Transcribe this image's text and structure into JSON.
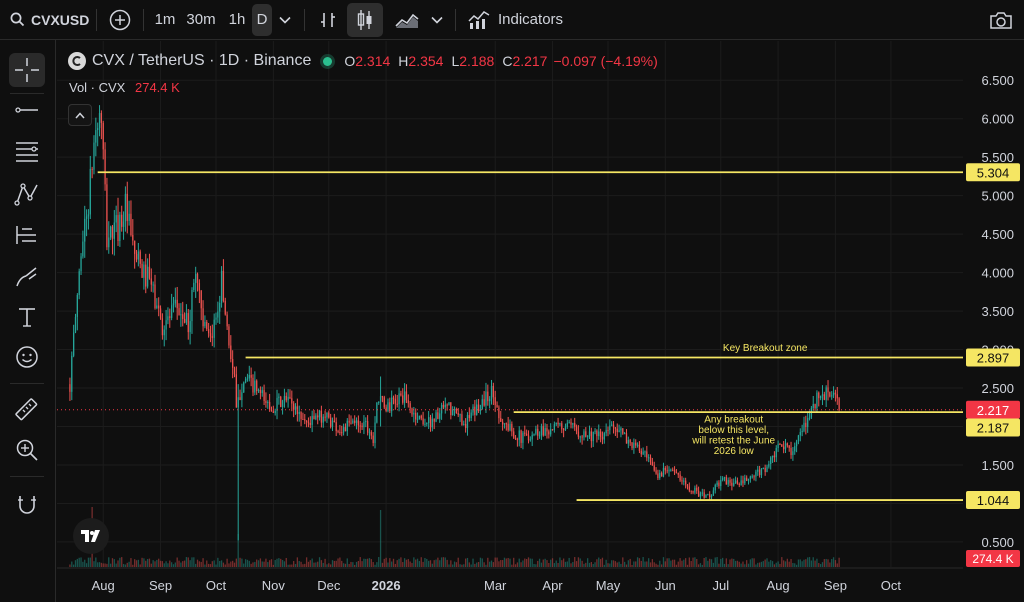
{
  "toolbar": {
    "symbol": "CVXUSD",
    "intervals": [
      "1m",
      "30m",
      "1h",
      "D"
    ],
    "active_interval": "D",
    "indicators_label": "Indicators"
  },
  "legend": {
    "title": "CVX / TetherUS · 1D · Binance",
    "open_key": "O",
    "open": "2.314",
    "high_key": "H",
    "high": "2.354",
    "low_key": "L",
    "low": "2.188",
    "close_key": "C",
    "close": "2.217",
    "change": "−0.097 (−4.19%)",
    "vol_label": "Vol · CVX",
    "vol_value": "274.4 K"
  },
  "colors": {
    "up": "#26a69a",
    "down": "#ef5350",
    "level_line": "#f5e663",
    "price_tag": "#f23645",
    "background": "#0f0f0f"
  },
  "sidebar_icons": [
    "crosshair-icon",
    "trend-line-icon",
    "fib-retracement-icon",
    "pattern-icon",
    "forecast-icon",
    "brush-icon",
    "text-icon",
    "emoji-icon",
    "ruler-icon",
    "zoom-in-icon",
    "magnet-icon"
  ],
  "chart_data": {
    "type": "candlestick",
    "y_ticks": [
      "6.500",
      "6.000",
      "5.500",
      "5.000",
      "4.500",
      "4.000",
      "3.500",
      "3.000",
      "2.500",
      "2.000",
      "1.500",
      "1.000",
      "0.500"
    ],
    "ylim": [
      0.2,
      6.75
    ],
    "x_ticks": [
      {
        "label": "Aug",
        "day": 0
      },
      {
        "label": "Sep",
        "day": 31
      },
      {
        "label": "Oct",
        "day": 61
      },
      {
        "label": "Nov",
        "day": 92
      },
      {
        "label": "Dec",
        "day": 122
      },
      {
        "label": "2026",
        "day": 153,
        "bold": true
      },
      {
        "label": "Mar",
        "day": 212
      },
      {
        "label": "Apr",
        "day": 243
      },
      {
        "label": "May",
        "day": 273
      },
      {
        "label": "Jun",
        "day": 304
      },
      {
        "label": "Jul",
        "day": 334
      },
      {
        "label": "Aug",
        "day": 365
      },
      {
        "label": "Sep",
        "day": 396
      },
      {
        "label": "Oct",
        "day": 426
      }
    ],
    "x_range_days": [
      -25,
      465
    ],
    "levels": [
      {
        "price": 5.304,
        "label": "5.304",
        "start_day": -3
      },
      {
        "price": 2.897,
        "label": "2.897",
        "start_day": 77
      },
      {
        "price": 2.187,
        "label": "2.187",
        "start_day": 222
      },
      {
        "price": 1.044,
        "label": "1.044",
        "start_day": 256
      }
    ],
    "last_price": {
      "price": 2.217,
      "label": "2.217"
    },
    "volume_tag": "274.4 K",
    "annotations": [
      {
        "text": "Key Breakout zone",
        "day": 358,
        "price": 2.98
      },
      {
        "lines": [
          "Any breakout",
          "below this level,",
          "will retest the June",
          "2026 low"
        ],
        "day": 341,
        "price": 2.05
      }
    ],
    "anchors": [
      [
        -18,
        2.55
      ],
      [
        -12,
        4.3
      ],
      [
        -8,
        4.9
      ],
      [
        -4,
        5.9
      ],
      [
        -1,
        6.0
      ],
      [
        2,
        4.45
      ],
      [
        8,
        4.6
      ],
      [
        12,
        4.85
      ],
      [
        16,
        4.3
      ],
      [
        21,
        4.0
      ],
      [
        25,
        3.9
      ],
      [
        32,
        3.3
      ],
      [
        40,
        3.55
      ],
      [
        46,
        3.3
      ],
      [
        50,
        4.05
      ],
      [
        55,
        3.25
      ],
      [
        58,
        3.05
      ],
      [
        62,
        3.6
      ],
      [
        64,
        3.9
      ],
      [
        68,
        3.1
      ],
      [
        71,
        2.6
      ],
      [
        72,
        2.2
      ],
      [
        76,
        2.65
      ],
      [
        82,
        2.5
      ],
      [
        90,
        2.25
      ],
      [
        100,
        2.35
      ],
      [
        110,
        2.05
      ],
      [
        120,
        2.15
      ],
      [
        128,
        1.95
      ],
      [
        136,
        2.05
      ],
      [
        142,
        2.05
      ],
      [
        146,
        1.85
      ],
      [
        148,
        2.35
      ],
      [
        154,
        2.25
      ],
      [
        162,
        2.4
      ],
      [
        168,
        2.15
      ],
      [
        176,
        2.05
      ],
      [
        186,
        2.25
      ],
      [
        196,
        2.05
      ],
      [
        206,
        2.35
      ],
      [
        210,
        2.45
      ],
      [
        216,
        2.05
      ],
      [
        226,
        1.85
      ],
      [
        236,
        1.95
      ],
      [
        250,
        2.0
      ],
      [
        262,
        1.9
      ],
      [
        270,
        1.85
      ],
      [
        276,
        2.05
      ],
      [
        282,
        1.85
      ],
      [
        292,
        1.65
      ],
      [
        300,
        1.35
      ],
      [
        306,
        1.5
      ],
      [
        312,
        1.3
      ],
      [
        318,
        1.2
      ],
      [
        324,
        1.1
      ],
      [
        328,
        1.1
      ],
      [
        334,
        1.3
      ],
      [
        344,
        1.25
      ],
      [
        352,
        1.35
      ],
      [
        360,
        1.5
      ],
      [
        366,
        1.75
      ],
      [
        372,
        1.7
      ],
      [
        378,
        1.9
      ],
      [
        384,
        2.3
      ],
      [
        388,
        2.4
      ],
      [
        394,
        2.45
      ],
      [
        398,
        2.217
      ]
    ],
    "spikes": [
      {
        "day": 73,
        "high": 2.55,
        "low": 0.52
      },
      {
        "day": 150,
        "high": 2.65,
        "low": 2.0
      }
    ],
    "volume_spikes": [
      {
        "day": -6,
        "size": 1.0
      },
      {
        "day": 73,
        "size": 0.55
      },
      {
        "day": 150,
        "size": 0.95
      }
    ]
  }
}
